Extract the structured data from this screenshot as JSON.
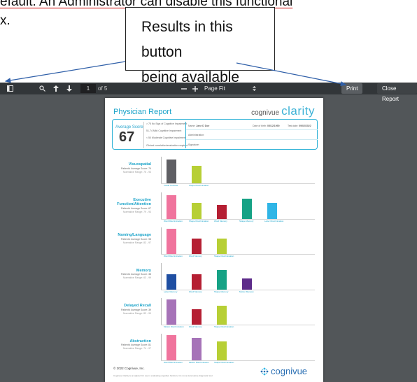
{
  "document": {
    "line1": "efault. An Administrator can disable this functional",
    "line2": "x."
  },
  "callout": {
    "line1": "Results in this button",
    "line2": "being available"
  },
  "viewer": {
    "page_current": "1",
    "page_of": "of 5",
    "zoom_label": "Page Fit",
    "print_label": "Print",
    "close_label": "Close Report",
    "icons": [
      "sidebar-icon",
      "search-icon",
      "arrow-up-icon",
      "arrow-down-icon",
      "minus-icon",
      "plus-icon",
      "dropdown-icon"
    ]
  },
  "report": {
    "title": "Physician Report",
    "brand_prefix": "cognivue",
    "brand_name": "clarity",
    "avg_label": "Average Score",
    "avg_score": "67",
    "legend": [
      {
        "range": "> 75",
        "text": "No Sign of Cognitive Impairment"
      },
      {
        "range": "51-74",
        "text": "Mild Cognitive Impairment"
      },
      {
        "range": "< 50",
        "text": "Moderate Cognitive Impairment"
      }
    ],
    "legend_note": "Clinical correlation/evaluation required",
    "fields": {
      "name_label": "Name:",
      "name_value": "Jane D Doe",
      "dob_label": "Date of birth:",
      "dob_value": "05/12/1990",
      "test_label": "Test date:",
      "test_value": "09/02/2022",
      "admin_label": "Administration:",
      "sig_label": "Signature:"
    },
    "sections": [
      {
        "title": "Visuospatial",
        "score": "Patient's Average Score: 79",
        "range": "Normative Range: 75 - 93",
        "bars": [
          {
            "label": "Visual Contrast",
            "value": 0.95,
            "color": "#5f5f64"
          },
          {
            "label": "Shape Discrimination",
            "value": 0.7,
            "color": "#b7cf35"
          }
        ]
      },
      {
        "title": "Executive Function/Attention",
        "score": "Patient's Average Score: 67",
        "range": "Normative Range: 79 - 93",
        "bars": [
          {
            "label": "Word Discrimination",
            "value": 0.95,
            "color": "#f0749d"
          },
          {
            "label": "Shape Discrimination",
            "value": 0.65,
            "color": "#b7cf35"
          },
          {
            "label": "Word Memory",
            "value": 0.55,
            "color": "#b51f33"
          },
          {
            "label": "Shape Memory",
            "value": 0.8,
            "color": "#16a285"
          },
          {
            "label": "Letter Discrimination",
            "value": 0.65,
            "color": "#2fb5e6"
          }
        ]
      },
      {
        "title": "Naming/Language",
        "score": "Patient's Average Score: 98",
        "range": "Normative Range: 83 - 97",
        "bars": [
          {
            "label": "Word Discrimination",
            "value": 1.0,
            "color": "#f0749d"
          },
          {
            "label": "Word Memory",
            "value": 0.6,
            "color": "#b51f33"
          },
          {
            "label": "Shape Discrimination",
            "value": 0.62,
            "color": "#b7cf35"
          }
        ]
      },
      {
        "title": "Memory",
        "score": "Patient's Average Score: 38",
        "range": "Normative Range: 63 - 99",
        "bars": [
          {
            "label": "Letter Memory",
            "value": 0.6,
            "color": "#1f4fa2"
          },
          {
            "label": "Word Memory",
            "value": 0.6,
            "color": "#b51f33"
          },
          {
            "label": "Shape Memory",
            "value": 0.78,
            "color": "#16a285"
          },
          {
            "label": "Motion Memory",
            "value": 0.45,
            "color": "#5d2c8a"
          }
        ]
      },
      {
        "title": "Delayed Recall",
        "score": "Patient's Average Score: 39",
        "range": "Normative Range: 83 - 99",
        "bars": [
          {
            "label": "Motion Discrimination",
            "value": 1.0,
            "color": "#a673b8"
          },
          {
            "label": "Word Memory",
            "value": 0.62,
            "color": "#b51f33"
          },
          {
            "label": "Shape Discrimination",
            "value": 0.75,
            "color": "#b7cf35"
          }
        ]
      },
      {
        "title": "Abstraction",
        "score": "Patient's Average Score: 81",
        "range": "Normative Range: 74 - 97",
        "bars": [
          {
            "label": "Word Discrimination",
            "value": 1.0,
            "color": "#f0749d"
          },
          {
            "label": "Motion Discrimination",
            "value": 0.9,
            "color": "#a673b8"
          },
          {
            "label": "Shape Discrimination",
            "value": 0.75,
            "color": "#b7cf35"
          }
        ]
      }
    ],
    "footer_copy": "© 2022 Cognivue, Inc.",
    "footer_note": "Cognivue Clarity is an adjunct for use in evaluating cognitive function; it is not a stand-alone diagnostic tool.",
    "footer_brand": "cognivue"
  }
}
